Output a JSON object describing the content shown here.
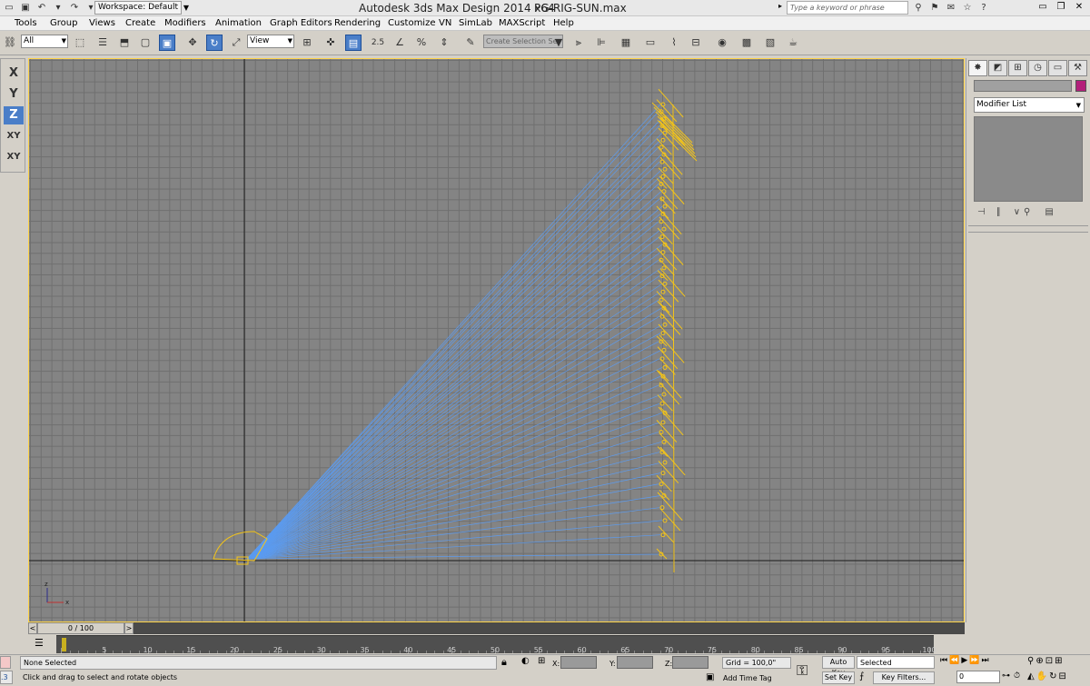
{
  "titlebar": {
    "workspace": "Workspace: Default",
    "app_title": "Autodesk 3ds Max Design 2014 x64",
    "file_name": "PG-RIG-SUN.max",
    "search_placeholder": "Type a keyword or phrase"
  },
  "menu": [
    "Tools",
    "Group",
    "Views",
    "Create",
    "Modifiers",
    "Animation",
    "Graph Editors",
    "Rendering",
    "Customize",
    "VN",
    "SimLab",
    "MAXScript",
    "Help"
  ],
  "toolbar": {
    "selection_filter": "All",
    "ref_coord": "View",
    "named_selection": "Create Selection Se",
    "snap_label": "2.5"
  },
  "axes": [
    "X",
    "Y",
    "Z",
    "XY",
    "XY"
  ],
  "active_axis": "Z",
  "command_panel": {
    "modifier_list": "Modifier List",
    "object_color": "#b3207a"
  },
  "time_slider": {
    "position": "0 / 100",
    "prev": "<",
    "next": ">"
  },
  "trackbar": {
    "ticks": [
      "5",
      "10",
      "15",
      "20",
      "25",
      "30",
      "35",
      "40",
      "45",
      "50",
      "55",
      "60",
      "65",
      "70",
      "75",
      "80",
      "85",
      "90",
      "95",
      "100"
    ]
  },
  "status": {
    "selection": "None Selected",
    "prompt": "Click and drag to select and rotate objects",
    "x_label": "X:",
    "y_label": "Y:",
    "z_label": "Z:",
    "grid": "Grid = 100,0\"",
    "add_time_tag": "Add Time Tag",
    "auto_key": "Auto Key",
    "set_key": "Set Key",
    "key_mode": "Selected",
    "key_filters": "Key Filters...",
    "current_frame": "0",
    "left_stat": ".3"
  },
  "colors": {
    "viewport_bg": "#848484",
    "ray_color": "#5b9bf0",
    "object_color": "#f5c518",
    "active_blue": "#4a7ec8"
  }
}
